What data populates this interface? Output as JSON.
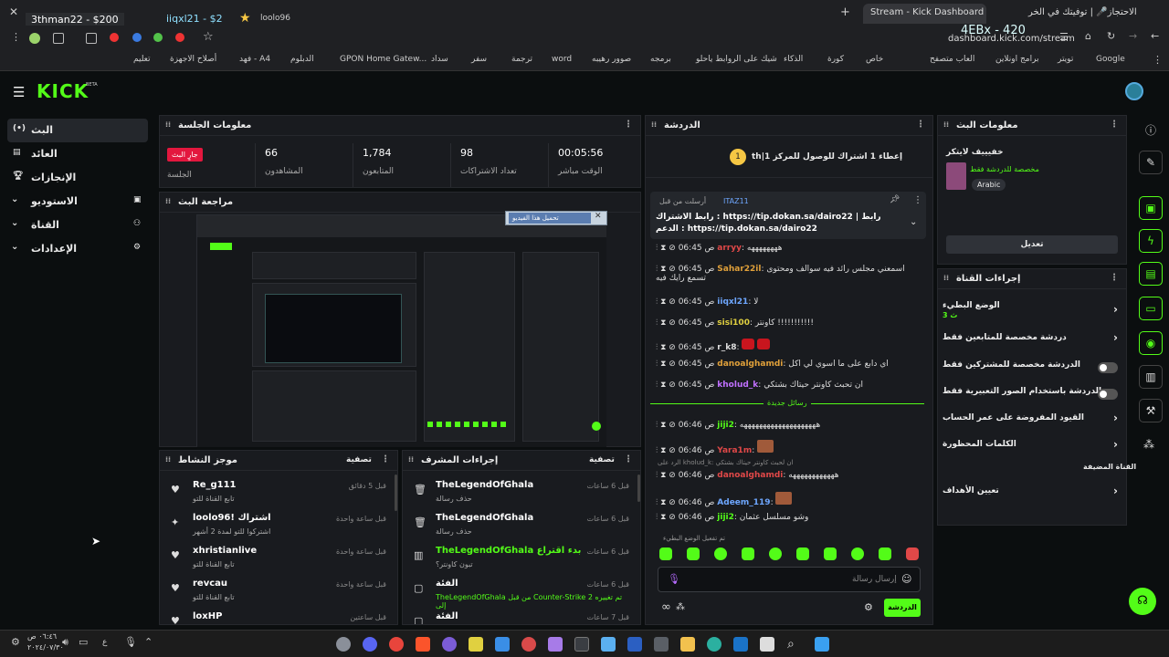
{
  "browser": {
    "tabs": [
      "Stream - Kick Dashboard",
      "غرفة الاحتجاز🎤 | توفيتك في الخر..."
    ],
    "overlay_name": "3thman22 - $200",
    "overlay_name2": "iiqxl21 - $2",
    "overlay_name3": "loolo96",
    "url": "dashboard.kick.com/stream",
    "overlay_code": "4EBx - 420",
    "bookmarks": [
      "Google",
      "تويتر",
      "برامج اونلاين",
      "العاب متصفح",
      "خاص",
      "كورة",
      "الذكاء",
      "شيك على الروابط ياحلو",
      "برمجه",
      "صوور رهيبه",
      "word",
      "ترجمة",
      "سفر",
      "سداد",
      "GPON Home Gatew...",
      "الدبلوم",
      "فهد - A4",
      "أصلاح الاجهزة",
      "تعليم"
    ]
  },
  "header": {
    "logo": "KICK",
    "beta": "BETA"
  },
  "sidebar": {
    "items": [
      {
        "label": "البث",
        "icon": "live-icon"
      },
      {
        "label": "العائد",
        "icon": "revenue-icon"
      },
      {
        "label": "الإنجازات",
        "icon": "trophy-icon"
      },
      {
        "label": "الاستوديو",
        "icon": "studio-icon"
      },
      {
        "label": "القناة",
        "icon": "channel-icon"
      },
      {
        "label": "الإعدادات",
        "icon": "settings-icon"
      }
    ]
  },
  "session": {
    "title": "معلومات الجلسة",
    "live_badge": "جارٍ البث",
    "session_label": "الجلسة",
    "stats": [
      {
        "value": "66",
        "label": "المشاهدون"
      },
      {
        "value": "1,784",
        "label": "المتابعون"
      },
      {
        "value": "98",
        "label": "تعداد الاشتراكات"
      },
      {
        "value": "00:05:56",
        "label": "الوقت مباشر"
      }
    ]
  },
  "preview": {
    "title": "مراجعة البث",
    "download_label": "تحميل هذا الفيديو"
  },
  "activity": {
    "title": "موجز النشاط",
    "filter": "تصفية",
    "items": [
      {
        "name": "Re_g111",
        "sub": "تابع القناة للتو",
        "time": "قبل 5 دقائق",
        "icon": "heart-icon"
      },
      {
        "name": "loolo96! اشتراك",
        "sub": "اشتركوا للتو لمدة 2 أشهر",
        "time": "قبل ساعة واحدة",
        "icon": "sparkle-icon"
      },
      {
        "name": "xhristianlive",
        "sub": "تابع القناة للتو",
        "time": "قبل ساعة واحدة",
        "icon": "heart-icon"
      },
      {
        "name": "revcau",
        "sub": "تابع القناة للتو",
        "time": "قبل ساعة واحدة",
        "icon": "heart-icon"
      },
      {
        "name": "loxHP",
        "sub": "",
        "time": "قبل ساعتين",
        "icon": "heart-icon"
      }
    ]
  },
  "modactions": {
    "title": "إجراءات المشرف",
    "filter": "تصفية",
    "items": [
      {
        "name": "TheLegendOfGhala",
        "sub": "حذف رسالة",
        "time": "قبل 6 ساعات"
      },
      {
        "name": "TheLegendOfGhala",
        "sub": "حذف رسالة",
        "time": "قبل 6 ساعات"
      },
      {
        "name": "TheLegendOfGhala بدء اقتراع",
        "sub": "تبون كاونتر؟",
        "time": "قبل 6 ساعات"
      },
      {
        "name": "الفئة",
        "sub": "TheLegendOfGhala من قبل Counter-Strike 2 تم تغييره إلى",
        "time": "قبل 6 ساعات"
      },
      {
        "name": "الفئة",
        "sub": "",
        "time": "قبل 7 ساعات"
      }
    ]
  },
  "chat": {
    "title": "الدردشة",
    "goal": "th|إعطاء 1 اشتراك للوصول للمركز 1",
    "goal_rank": "1",
    "pinned_by": "أرسلت من قبل",
    "pinned_user": "ITAZ11",
    "pinned_text": "رابط الاشتراك : https://tip.dokan.sa/dairo22 | رابط الدعم : https://tip.dokan.sa/dairo22",
    "new_messages": "رسائل جديدة",
    "messages": [
      {
        "time": "06:45 ص",
        "user": "arryy",
        "text": ": ههههههههه",
        "color": "#e04848"
      },
      {
        "time": "06:45 ص",
        "user": "Sahar22il",
        "text": ": اسمعني مجلس رائد فيه سوالف ومحتوى تسمع رايك فيه",
        "color": "#e0a03a"
      },
      {
        "time": "06:45 ص",
        "user": "iiqxl21",
        "text": ": لا",
        "color": "#6ea7ff"
      },
      {
        "time": "06:45 ص",
        "user": "sisi100",
        "text": ": كاونتر !!!!!!!!!!!",
        "color": "#e0d040"
      },
      {
        "time": "06:45 ص",
        "user": "r_k8",
        "text": ":",
        "color": "#eee"
      },
      {
        "time": "06:45 ص",
        "user": "danoalghamdi",
        "text": ": اي دابع على ما اسوي لي اكل",
        "color": "#e0a03a"
      },
      {
        "time": "06:45 ص",
        "user": "kholud_k",
        "text": ": ان تحبث كاونتر حيتاك بشتكي",
        "color": "#c070ff"
      },
      {
        "time": "06:46 ص",
        "user": "jiji2",
        "text": ": ههههههههههههههههههههه",
        "color": "#53fc18"
      },
      {
        "time": "06:46 ص",
        "user": "Yara1m",
        "text": ":",
        "color": "#e04848"
      },
      {
        "time": "06:46 ص",
        "user": "danoalghamdi",
        "text": ": ههههههههههههه",
        "color": "#e04848"
      },
      {
        "time": "06:46 ص",
        "user": "Adeem_119",
        "text": ":",
        "color": "#6ea7ff"
      },
      {
        "time": "06:46 ص",
        "user": "jiji2",
        "text": ": وشو مسلسل عثمان",
        "color": "#53fc18"
      }
    ],
    "reply_note": "الرد على kholud_k: ان لحبث كاونتر حيتاك بشتكي",
    "emote_note": "تم تفعيل الوضع البطيء",
    "input_placeholder": "إرسال رسالة",
    "send_label": "الدردشة"
  },
  "streaminfo": {
    "title": "معلومات البث",
    "stream_title": "خفيييف لايتكر",
    "category": "مخصصة للدردشة فقط",
    "language": "Arabic",
    "edit_label": "تعديل"
  },
  "channel_actions": {
    "title": "إجراءات القناة",
    "rows": [
      {
        "label": "الوضع البطيء",
        "value": "3 ث"
      },
      {
        "label": "دردشة مخصصة للمتابعين فقط",
        "value": ""
      },
      {
        "label": "الدردشة مخصصة للمشتركين فقط",
        "value": ""
      },
      {
        "label": "الدردشة باستخدام الصور التعبيرية فقط",
        "value": ""
      },
      {
        "label": "القيود المفروضة على عمر الحساب",
        "value": ""
      },
      {
        "label": "الكلمات المحظورة",
        "value": ""
      }
    ],
    "hosting_title": "القناة المضيفة",
    "target_label": "تعيين الأهداف"
  },
  "taskbar": {
    "time": "٠٦:٤٦ ص",
    "date": "٢٠٢٤/٠٧/٣٠",
    "lang": "ع"
  }
}
